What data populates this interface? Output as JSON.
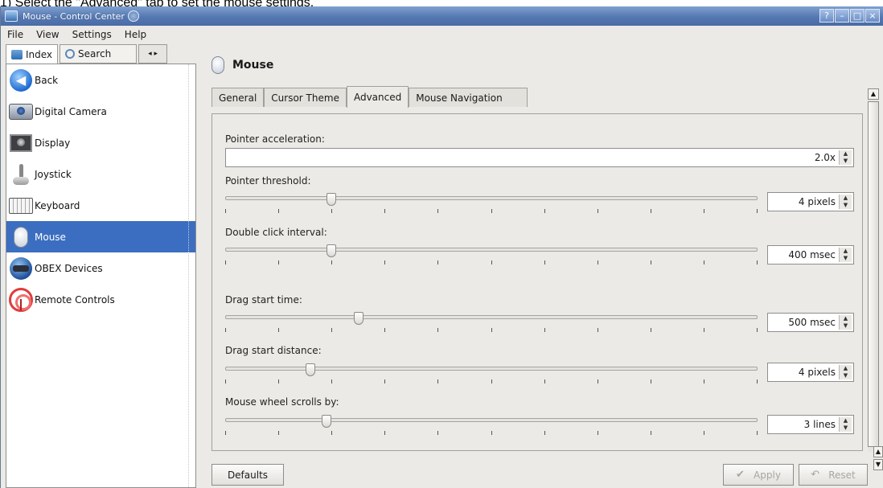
{
  "instruction": "1) Select the \"Advanced\" tab to set the mouse settings.",
  "window": {
    "title": "Mouse - Control Center",
    "buttons": [
      "?",
      "–",
      "□",
      "×"
    ]
  },
  "menu": [
    "File",
    "View",
    "Settings",
    "Help"
  ],
  "left_tabs": {
    "index": "Index",
    "search": "Search",
    "arrows": "◂ ▸"
  },
  "modules": [
    {
      "label": "Back",
      "icon": "back-icon"
    },
    {
      "label": "Digital Camera",
      "icon": "camera-icon"
    },
    {
      "label": "Display",
      "icon": "display-icon"
    },
    {
      "label": "Joystick",
      "icon": "joystick-icon"
    },
    {
      "label": "Keyboard",
      "icon": "keyboard-icon"
    },
    {
      "label": "Mouse",
      "icon": "mouse-icon",
      "selected": true
    },
    {
      "label": "OBEX Devices",
      "icon": "obex-icon"
    },
    {
      "label": "Remote Controls",
      "icon": "remote-icon"
    }
  ],
  "panel": {
    "title": "Mouse",
    "tabs": [
      "General",
      "Cursor Theme",
      "Advanced",
      "Mouse Navigation"
    ],
    "active_tab": "Advanced"
  },
  "settings": {
    "pointer_acceleration": {
      "label": "Pointer acceleration:",
      "value": "2.0x"
    },
    "pointer_threshold": {
      "label": "Pointer threshold:",
      "value": "4 pixels",
      "level": 0.2
    },
    "double_click_interval": {
      "label": "Double click interval:",
      "value": "400 msec",
      "level": 0.2
    },
    "drag_start_time": {
      "label": "Drag start time:",
      "value": "500 msec",
      "level": 0.25
    },
    "drag_start_distance": {
      "label": "Drag start distance:",
      "value": "4 pixels",
      "level": 0.16
    },
    "mouse_wheel_scrolls": {
      "label": "Mouse wheel scrolls by:",
      "value": "3 lines",
      "level": 0.19
    }
  },
  "footer": {
    "defaults": "Defaults",
    "apply": "Apply",
    "reset": "Reset"
  },
  "colors": {
    "selection": "#3b6ec1",
    "titlebar": "#5478b2",
    "panel": "#eceae6"
  }
}
